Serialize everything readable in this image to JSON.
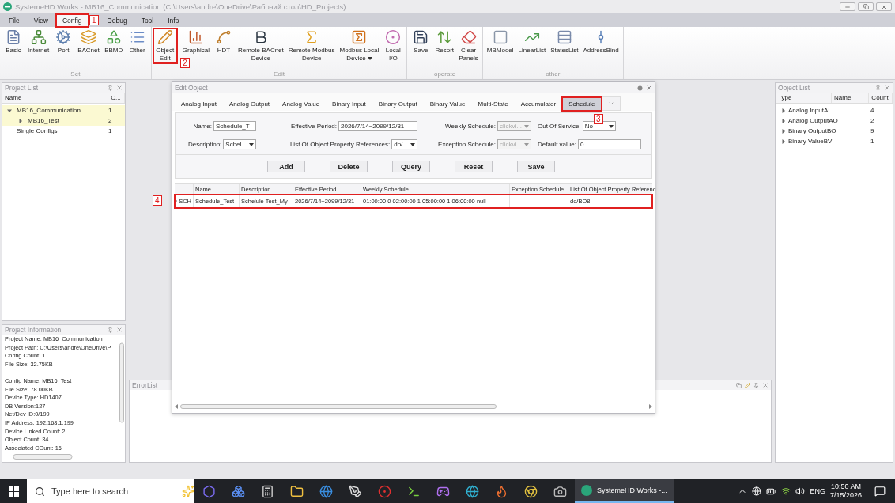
{
  "window": {
    "title": "SystemeHD Works - MB16_Communication (C:\\Users\\andre\\OneDrive\\Рабочий стол\\HD_Projects)"
  },
  "menu": [
    {
      "label": "File",
      "selected": false
    },
    {
      "label": "View",
      "selected": false
    },
    {
      "label": "Config",
      "selected": true,
      "callout": "1"
    },
    {
      "label": "Debug",
      "selected": false
    },
    {
      "label": "Tool",
      "selected": false
    },
    {
      "label": "Info",
      "selected": false
    }
  ],
  "ribbon": [
    {
      "group": "Set",
      "buttons": [
        {
          "label": "Basic"
        },
        {
          "label": "Internet"
        },
        {
          "label": "Port"
        },
        {
          "label": "BACnet"
        },
        {
          "label": "BBMD"
        },
        {
          "label": "Other"
        }
      ]
    },
    {
      "group": "Edit",
      "buttons": [
        {
          "label": "Object\nEdit",
          "callout": "2"
        },
        {
          "label": "Graphical"
        },
        {
          "label": "HDT"
        },
        {
          "label": "Remote BACnet\nDevice"
        },
        {
          "label": "Remote Modbus\nDevice"
        },
        {
          "label": "Modbus Local\nDevice",
          "dropdown": true
        },
        {
          "label": "Local\nI/O"
        }
      ]
    },
    {
      "group": "operate",
      "buttons": [
        {
          "label": "Save"
        },
        {
          "label": "Resort"
        },
        {
          "label": "Clear\nPanels"
        }
      ]
    },
    {
      "group": "other",
      "buttons": [
        {
          "label": "MBModel"
        },
        {
          "label": "LinearList"
        },
        {
          "label": "StatesList"
        },
        {
          "label": "AddressBind"
        }
      ]
    }
  ],
  "project_list": {
    "title": "Project List",
    "columns": [
      "Name",
      "C..."
    ],
    "items": [
      {
        "name": "MB16_Communication",
        "count": "1",
        "selected": true,
        "expanded": true,
        "children": [
          {
            "name": "MB16_Test",
            "count": "2",
            "selected": true,
            "expanded": false
          }
        ]
      },
      {
        "name": "Single Configs",
        "count": "1",
        "selected": false
      }
    ]
  },
  "project_info": {
    "title": "Project Information",
    "sections": [
      [
        "Project Name: MB16_Communication",
        "Project Path: C:\\Users\\andre\\OneDrive\\P",
        "Config Count: 1",
        "File Size: 32.75KB"
      ],
      [
        "Config Name: MB16_Test",
        "File Size: 78.00KB",
        "Device Type: HD1407",
        "DB Version:127",
        "Net/Dev ID:0/199",
        "IP Address: 192.168.1.199",
        "Device Linked Count: 2",
        "Object Count: 34",
        "Associated COunt: 16"
      ]
    ]
  },
  "error_list": {
    "title": "ErrorList"
  },
  "edit_object": {
    "title": "Edit Object",
    "tabs": [
      {
        "label": "Analog Input",
        "selected": false
      },
      {
        "label": "Analog Output",
        "selected": false
      },
      {
        "label": "Analog Value",
        "selected": false
      },
      {
        "label": "Binary Input",
        "selected": false
      },
      {
        "label": "Binary Output",
        "selected": false
      },
      {
        "label": "Binary Value",
        "selected": false
      },
      {
        "label": "Multi-State",
        "selected": false
      },
      {
        "label": "Accumulator",
        "selected": false
      },
      {
        "label": "Schedule",
        "selected": true,
        "callout": "3"
      }
    ],
    "form_rows": [
      [
        {
          "label": "Name:",
          "kind": "text",
          "value": "Schedule_T"
        },
        {
          "label": "Effective Period:",
          "kind": "text",
          "value": "2026/7/14~2099/12/31"
        },
        {
          "label": "Weekly Schedule:",
          "kind": "dropdown",
          "value": "clickvi...",
          "disabled": true
        },
        {
          "label": "Out Of Service:",
          "kind": "dropdown",
          "value": "No",
          "disabled": false
        }
      ],
      [
        {
          "label": "Description:",
          "kind": "dropdown",
          "value": "Schel...",
          "disabled": false
        },
        {
          "label": "List Of Object Property References:",
          "kind": "dropdown",
          "value": "do/...",
          "disabled": false
        },
        {
          "label": "Exception Schedule:",
          "kind": "dropdown",
          "value": "clickvi...",
          "disabled": true
        },
        {
          "label": "Default value:",
          "kind": "text",
          "value": "0"
        }
      ]
    ],
    "buttons": [
      "Add",
      "Delete",
      "Query",
      "Reset",
      "Save"
    ],
    "table": {
      "columns": [
        "Name",
        "Description",
        "Effective Period",
        "Weekly Schedule",
        "Exception Schedule",
        "List Of Object Property Referenc"
      ],
      "rows": [
        {
          "type": "SCH",
          "name": "Schedule_Test",
          "description": "Schelule Test_My",
          "effective_period": "2026/7/14~2099/12/31",
          "weekly_schedule": "01:00:00 0 02:00:00 1 05:00:00 1 06:00:00 null",
          "references": "do/BO8",
          "callout": "4"
        }
      ]
    }
  },
  "object_list": {
    "title": "Object List",
    "columns": [
      "Type",
      "Name",
      "Count"
    ],
    "rows": [
      {
        "type": "Analog InputAI",
        "count": "4",
        "expanded": false
      },
      {
        "type": "Analog OutputAO",
        "count": "2",
        "expanded": false
      },
      {
        "type": "Binary OutputBO",
        "count": "9",
        "expanded": false
      },
      {
        "type": "Binary ValueBV",
        "count": "1",
        "expanded": false
      }
    ]
  },
  "taskbar": {
    "search_placeholder": "Type here to search",
    "active_app": "SystemeHD Works -...",
    "language": "ENG",
    "time": "10:50 AM",
    "date": "7/15/2026"
  }
}
